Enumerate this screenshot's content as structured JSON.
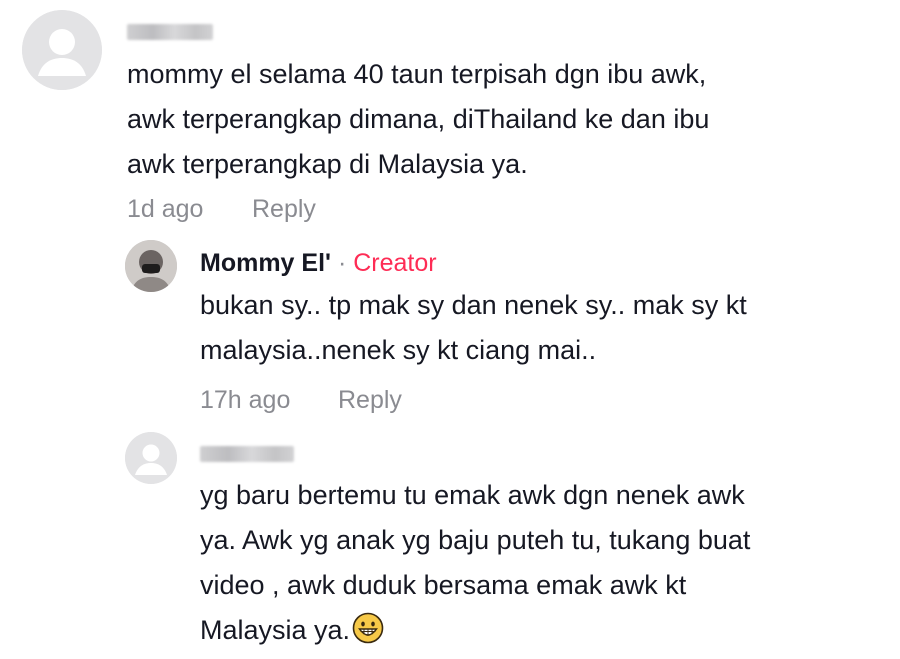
{
  "comments": [
    {
      "username": "",
      "text": "mommy el selama 40 taun terpisah dgn ibu awk,\nawk terperangkap dimana, diThailand ke dan ibu\nawk terperangkap di Malaysia ya.",
      "time": "1d ago",
      "reply_label": "Reply"
    },
    {
      "username": "Mommy El'",
      "separator": "·",
      "badge": "Creator",
      "text": "bukan sy.. tp mak sy dan nenek sy.. mak sy kt\nmalaysia..nenek sy kt ciang mai..",
      "time": "17h ago",
      "reply_label": "Reply"
    },
    {
      "username": "",
      "text": "yg baru bertemu tu emak awk dgn nenek awk\nya. Awk yg anak yg baju puteh tu, tukang buat\nvideo , awk duduk bersama emak awk kt\nMalaysia ya.",
      "emoji": "grinning-face-emoji"
    }
  ],
  "colors": {
    "text": "#161823",
    "meta": "#8a8b91",
    "creator_badge": "#fe2c55",
    "avatar_bg": "#e3e3e5"
  }
}
